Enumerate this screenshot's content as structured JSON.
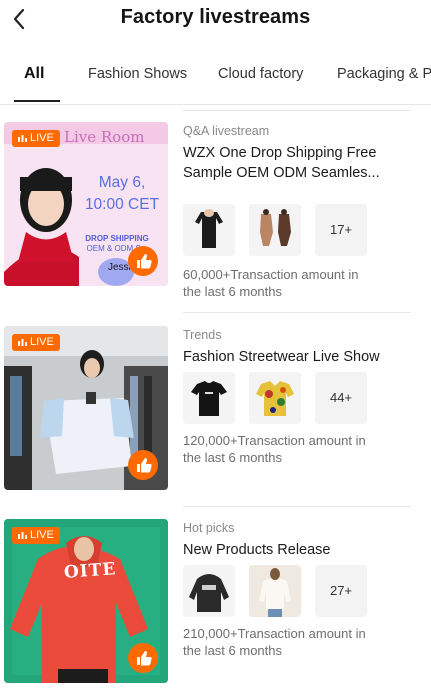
{
  "header": {
    "title": "Factory livestreams",
    "back_icon": "chevron-left-icon"
  },
  "tabs": [
    {
      "label": "All",
      "active": true
    },
    {
      "label": "Fashion Shows",
      "active": false
    },
    {
      "label": "Cloud factory",
      "active": false
    },
    {
      "label": "Packaging & P",
      "active": false
    }
  ],
  "colors": {
    "accent": "#ff6a00",
    "live_badge": "#ff6a00",
    "tab_underline": "#222222"
  },
  "cards": [
    {
      "category": "Q&A livestream",
      "name": "WZX One Drop Shipping Free Sample OEM ODM Seamles...",
      "more_count": "17+",
      "stat_line1": "60,000+Transaction amount in",
      "stat_line2": "the last 6 months",
      "thumb": {
        "live_label": "LIVE",
        "room_title": "Live Room",
        "date_line1": "May 6,",
        "date_line2": "10:00 CET",
        "badge_line1": "DROP SHIPPING",
        "badge_line2": "OEM & ODM S...",
        "presenter": "Jessica"
      },
      "products": [
        "black-longsleeve-top",
        "brown-bodysuits"
      ]
    },
    {
      "category": "Trends",
      "name": "Fashion Streetwear Live Show",
      "more_count": "44+",
      "stat_line1": "120,000+Transaction amount in",
      "stat_line2": "the last 6 months",
      "thumb": {
        "live_label": "LIVE"
      },
      "products": [
        "black-tshirt",
        "floral-hawaiian-shirt"
      ]
    },
    {
      "category": "Hot picks",
      "name": "New Products Release",
      "more_count": "27+",
      "stat_line1": "210,000+Transaction amount in",
      "stat_line2": "the last 6 months",
      "thumb": {
        "live_label": "LIVE",
        "hoodie_text": "OITE"
      },
      "products": [
        "black-hoodie",
        "white-blouse"
      ]
    }
  ]
}
